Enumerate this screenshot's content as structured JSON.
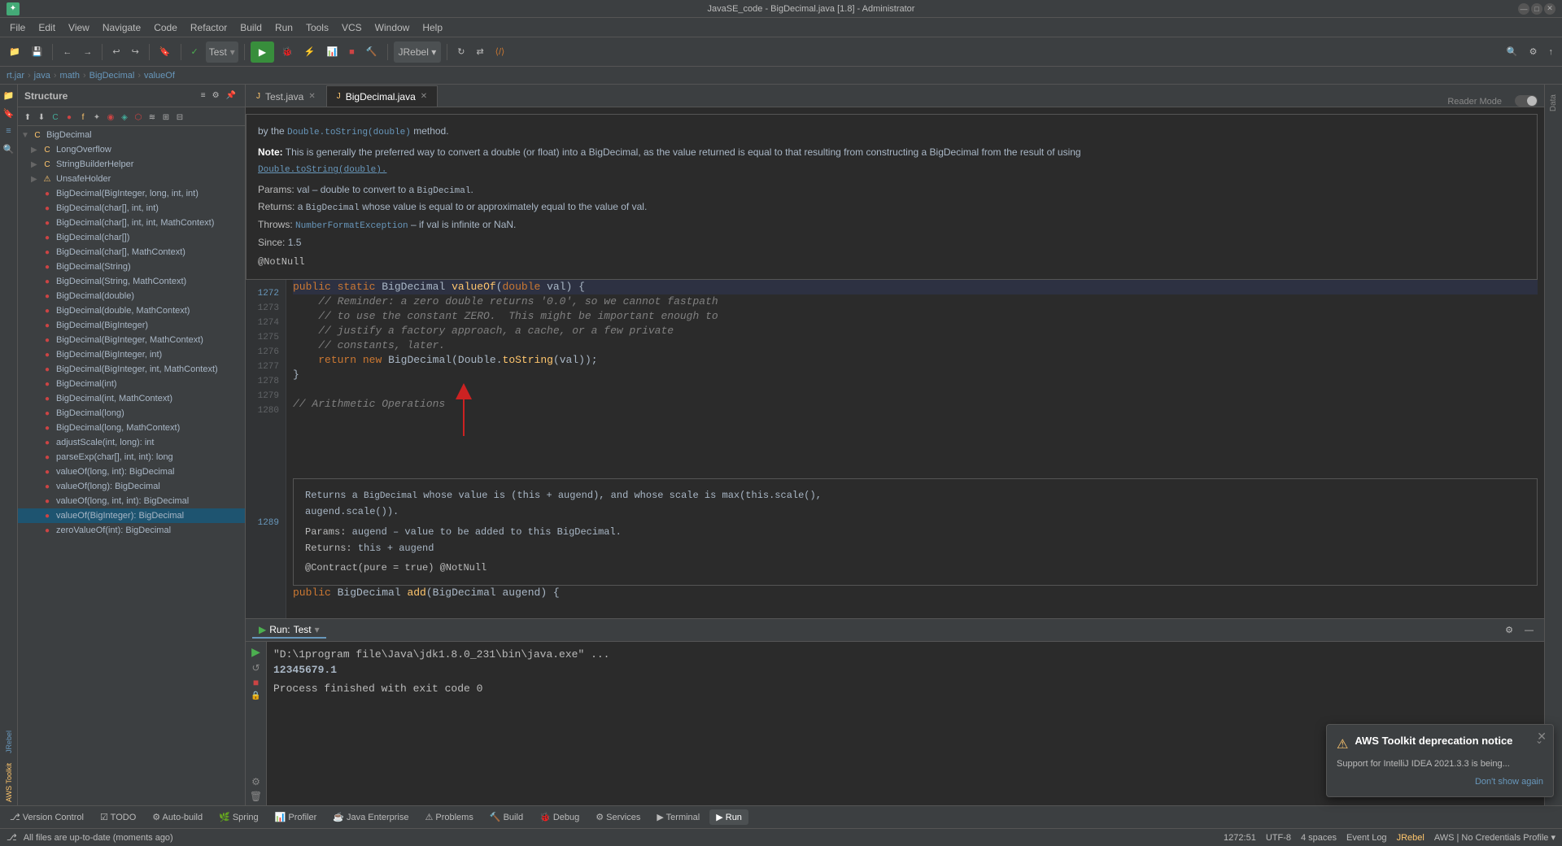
{
  "titleBar": {
    "title": "JavaSE_code - BigDecimal.java [1.8] - Administrator",
    "minimize": "—",
    "maximize": "□",
    "close": "✕"
  },
  "menuBar": {
    "appIcon": "♦",
    "items": [
      "File",
      "Edit",
      "View",
      "Navigate",
      "Code",
      "Refactor",
      "Build",
      "Run",
      "Tools",
      "VCS",
      "Window",
      "Help"
    ]
  },
  "toolbar": {
    "undoIcon": "↩",
    "redoIcon": "↪",
    "testLabel": "Test",
    "runLabel": "▶",
    "debugLabel": "🐞",
    "jrebelLabel": "JRebel ▾",
    "searchIcon": "🔍",
    "settingsIcon": "⚙",
    "buildIcon": "🔨"
  },
  "breadcrumb": {
    "items": [
      "rt.jar",
      "java",
      "math",
      "BigDecimal",
      "valueOf"
    ]
  },
  "structurePanel": {
    "title": "Structure",
    "treeItems": [
      {
        "label": "BigDecimal",
        "type": "class",
        "indent": 0,
        "expanded": true
      },
      {
        "label": "LongOverflow",
        "type": "class",
        "indent": 1,
        "expanded": false
      },
      {
        "label": "StringBuilderHelper",
        "type": "class",
        "indent": 1,
        "expanded": false
      },
      {
        "label": "UnsafeHolder",
        "type": "class",
        "indent": 1,
        "expanded": false
      },
      {
        "label": "BigDecimal(BigInteger, long, int, int)",
        "type": "method",
        "indent": 1
      },
      {
        "label": "BigDecimal(char[], int, int)",
        "type": "method",
        "indent": 1
      },
      {
        "label": "BigDecimal(char[], int, int, MathContext)",
        "type": "method",
        "indent": 1
      },
      {
        "label": "BigDecimal(char[])",
        "type": "method",
        "indent": 1
      },
      {
        "label": "BigDecimal(char[], MathContext)",
        "type": "method",
        "indent": 1
      },
      {
        "label": "BigDecimal(String)",
        "type": "method",
        "indent": 1
      },
      {
        "label": "BigDecimal(String, MathContext)",
        "type": "method",
        "indent": 1
      },
      {
        "label": "BigDecimal(double)",
        "type": "method",
        "indent": 1
      },
      {
        "label": "BigDecimal(double, MathContext)",
        "type": "method",
        "indent": 1
      },
      {
        "label": "BigDecimal(BigInteger)",
        "type": "method",
        "indent": 1
      },
      {
        "label": "BigDecimal(BigInteger, MathContext)",
        "type": "method",
        "indent": 1
      },
      {
        "label": "BigDecimal(BigInteger, int)",
        "type": "method",
        "indent": 1
      },
      {
        "label": "BigDecimal(BigInteger, int, MathContext)",
        "type": "method",
        "indent": 1
      },
      {
        "label": "BigDecimal(int)",
        "type": "method",
        "indent": 1
      },
      {
        "label": "BigDecimal(int, MathContext)",
        "type": "method",
        "indent": 1
      },
      {
        "label": "BigDecimal(long)",
        "type": "method",
        "indent": 1
      },
      {
        "label": "BigDecimal(long, MathContext)",
        "type": "method",
        "indent": 1
      },
      {
        "label": "adjustScale(int, long): int",
        "type": "method",
        "indent": 1
      },
      {
        "label": "parseExp(char[], int, int): long",
        "type": "method",
        "indent": 1
      },
      {
        "label": "valueOf(long, int): BigDecimal",
        "type": "method",
        "indent": 1
      },
      {
        "label": "valueOf(long): BigDecimal",
        "type": "method",
        "indent": 1
      },
      {
        "label": "valueOf(long, int, int): BigDecimal",
        "type": "method",
        "indent": 1
      },
      {
        "label": "valueOf(BigInteger): BigDecimal",
        "type": "method",
        "indent": 1,
        "selected": true
      },
      {
        "label": "zeroValueOf(int): BigDecimal",
        "type": "method",
        "indent": 1
      }
    ]
  },
  "editorTabs": [
    {
      "label": "Test.java",
      "active": false,
      "modified": false
    },
    {
      "label": "BigDecimal.java",
      "active": true,
      "modified": false
    }
  ],
  "codeContent": {
    "docBefore": {
      "byMethod": "by the Double.toString(double) method.",
      "noteLabel": "Note:",
      "noteText": "This is generally the preferred way to convert a double (or float) into a BigDecimal, as the value returned is equal to that resulting from constructing a BigDecimal from the result of using",
      "doubleToString": "Double.toString(double).",
      "paramsLabel": "Params:",
      "paramsText": "val – double to convert to a BigDecimal.",
      "returnsLabel": "Returns:",
      "returnsText": "a BigDecimal whose value is equal to or approximately equal to the value of val.",
      "throwsLabel": "Throws:",
      "throwsClass": "NumberFormatException",
      "throwsText": "– if val is infinite or NaN.",
      "sinceLabel": "Since:",
      "sinceVersion": "1.5",
      "annotation": "@NotNull"
    },
    "lines": [
      {
        "num": "1272",
        "bookmark": true,
        "content": "public static BigDecimal valueOf(double val) {",
        "type": "code",
        "highlighted": true
      },
      {
        "num": "1273",
        "content": "    // Reminder: a zero double returns '0.0', so we cannot fastpath",
        "type": "comment"
      },
      {
        "num": "1274",
        "content": "    // to use the constant ZERO.  This might be important enough to",
        "type": "comment"
      },
      {
        "num": "1275",
        "content": "    // justify a factory approach, a cache, or a few private",
        "type": "comment"
      },
      {
        "num": "1276",
        "content": "    // constants, later.",
        "type": "comment"
      },
      {
        "num": "1277",
        "content": "    return new BigDecimal(Double.toString(val));",
        "type": "code"
      },
      {
        "num": "1278",
        "content": "}",
        "type": "code"
      },
      {
        "num": "1279",
        "content": "",
        "type": "blank"
      },
      {
        "num": "1280",
        "content": "// Arithmetic Operations",
        "type": "comment"
      }
    ],
    "docAfter": {
      "returnsLabel": "Returns a",
      "returnsClass": "BigDecimal",
      "returnsDesc": "whose value is (this + augend), and whose scale is max(this.scale(),",
      "returnsDesc2": "augend.scale()).",
      "paramsLabel": "Params:",
      "paramsDesc": "augend – value to be added to this BigDecimal.",
      "returnsLabel2": "Returns:",
      "returnsDesc3": "this + augend",
      "annotation1": "@Contract(pure = true)",
      "annotation2": "@NotNull"
    },
    "line1289": {
      "num": "1289",
      "bookmark": true,
      "content": "public BigDecimal add(BigDecimal augend) {",
      "type": "code"
    }
  },
  "runPanel": {
    "title": "Run",
    "tabLabel": "Test",
    "runPath": "\"D:\\1program file\\Java\\jdk1.8.0_231\\bin\\java.exe\" ...",
    "output": "12345679.1",
    "exitMsg": "Process finished with exit code 0"
  },
  "footerTabs": [
    {
      "label": "Version Control",
      "icon": "⎇"
    },
    {
      "label": "TODO",
      "icon": "☑"
    },
    {
      "label": "Auto-build",
      "icon": "⚙"
    },
    {
      "label": "Spring",
      "icon": "🌿"
    },
    {
      "label": "Profiler",
      "icon": "📊"
    },
    {
      "label": "Java Enterprise",
      "icon": "☕"
    },
    {
      "label": "Problems",
      "icon": "⚠"
    },
    {
      "label": "Build",
      "icon": "🔨"
    },
    {
      "label": "Debug",
      "icon": "🐞"
    },
    {
      "label": "Services",
      "icon": "⚙"
    },
    {
      "label": "Terminal",
      "icon": "▶"
    },
    {
      "label": "Run",
      "icon": "▶",
      "active": true
    }
  ],
  "statusBar": {
    "leftText": "All files are up-to-date (moments ago)",
    "lineCol": "1272:51",
    "encoding": "UTF-8",
    "indentInfo": "4 spaces",
    "gitInfo": "AWS | No Credentials Profile ▾"
  },
  "awsNotification": {
    "icon": "⚠",
    "title": "AWS Toolkit deprecation notice",
    "body": "Support for IntelliJ IDEA 2021.3.3 is being...",
    "dontShowLabel": "Don't show again",
    "expandIcon": "⌄"
  },
  "readerMode": "Reader Mode"
}
